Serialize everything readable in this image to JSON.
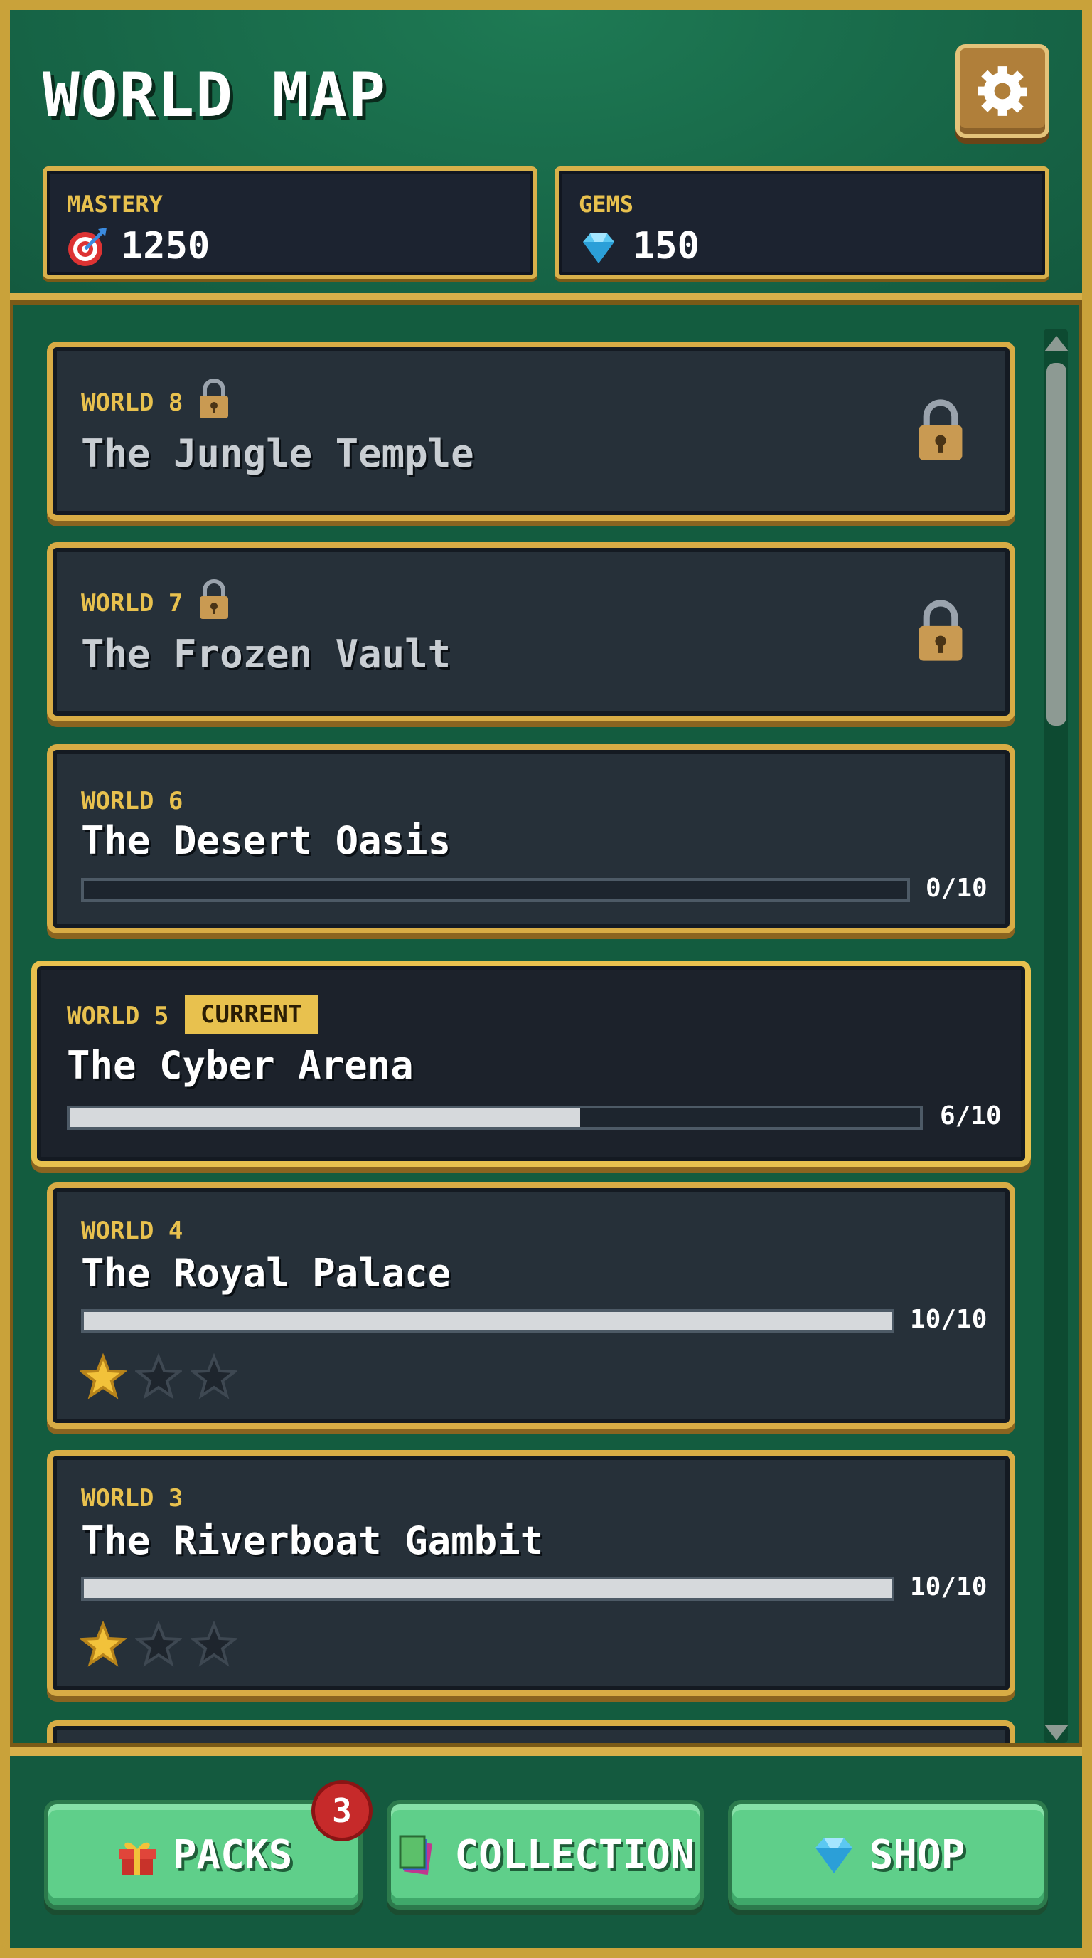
{
  "header": {
    "title": "WORLD MAP",
    "stats": {
      "mastery": {
        "label": "MASTERY",
        "value": "1250",
        "icon": "target-icon"
      },
      "gems": {
        "label": "GEMS",
        "value": "150",
        "icon": "gem-icon"
      }
    },
    "settings_icon": "gear-icon"
  },
  "worlds": [
    {
      "label": "WORLD 8",
      "name": "The Jungle Temple",
      "locked": true
    },
    {
      "label": "WORLD 7",
      "name": "The Frozen Vault",
      "locked": true
    },
    {
      "label": "WORLD 6",
      "name": "The Desert Oasis",
      "progress": "0/10",
      "progress_fraction": 0.0
    },
    {
      "label": "WORLD 5",
      "badge": "CURRENT",
      "name": "The Cyber Arena",
      "progress": "6/10",
      "progress_fraction": 0.6
    },
    {
      "label": "WORLD 4",
      "name": "The Royal Palace",
      "progress": "10/10",
      "progress_fraction": 1.0,
      "stars": 1,
      "stars_max": 3
    },
    {
      "label": "WORLD 3",
      "name": "The Riverboat Gambit",
      "progress": "10/10",
      "progress_fraction": 1.0,
      "stars": 1,
      "stars_max": 3
    }
  ],
  "footer": {
    "packs": {
      "label": "PACKS",
      "icon": "gift-icon",
      "notification": "3"
    },
    "collection": {
      "label": "COLLECTION",
      "icon": "cards-icon"
    },
    "shop": {
      "label": "SHOP",
      "icon": "gem-icon"
    }
  },
  "colors": {
    "felt_green": "#176647",
    "gold_border": "#d8ac45",
    "label_gold": "#e8c14e",
    "card_bg": "#263039",
    "button_green": "#5fcf8a",
    "notification_red": "#c62a2a"
  }
}
